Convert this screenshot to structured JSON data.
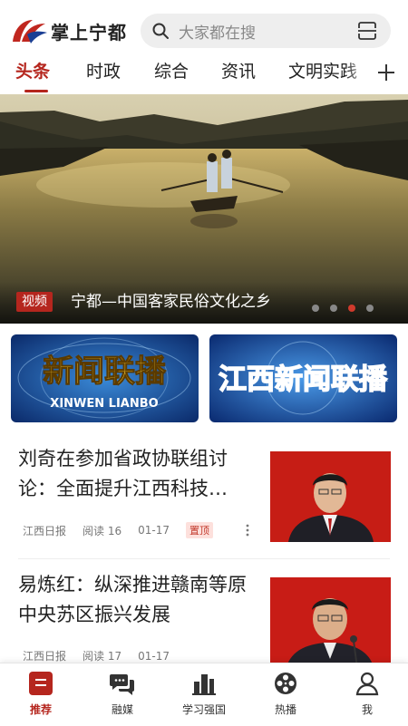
{
  "app": {
    "name": "掌上宁都"
  },
  "search": {
    "placeholder": "大家都在搜"
  },
  "tabs": [
    {
      "label": "头条",
      "active": true
    },
    {
      "label": "时政",
      "active": false
    },
    {
      "label": "综合",
      "active": false
    },
    {
      "label": "资讯",
      "active": false
    },
    {
      "label": "文明实践",
      "active": false
    }
  ],
  "banner": {
    "badge": "视频",
    "title": "宁都—中国客家民俗文化之乡",
    "slide_count": 4,
    "active_slide": 3
  },
  "features": [
    {
      "label": "新闻联播",
      "sub": "XINWEN LIANBO"
    },
    {
      "label": "江西新闻联播"
    }
  ],
  "articles": [
    {
      "title": "刘奇在参加省政协联组讨论：全面提升江西科技…",
      "source": "江西日报",
      "reads": "阅读 16",
      "date": "01-17",
      "pin": "置顶"
    },
    {
      "title": "易炼红：纵深推进赣南等原中央苏区振兴发展",
      "source": "江西日报",
      "reads": "阅读 17",
      "date": "01-17"
    }
  ],
  "bottom_nav": [
    {
      "label": "推荐",
      "icon": "recommend-icon",
      "active": true
    },
    {
      "label": "融媒",
      "icon": "chat-bubbles-icon",
      "active": false
    },
    {
      "label": "学习强国",
      "icon": "buildings-icon",
      "active": false
    },
    {
      "label": "热播",
      "icon": "film-reel-icon",
      "active": false
    },
    {
      "label": "我",
      "icon": "user-icon",
      "active": false
    }
  ],
  "colors": {
    "accent": "#b5261e",
    "pin_bg": "#fde0dc"
  }
}
